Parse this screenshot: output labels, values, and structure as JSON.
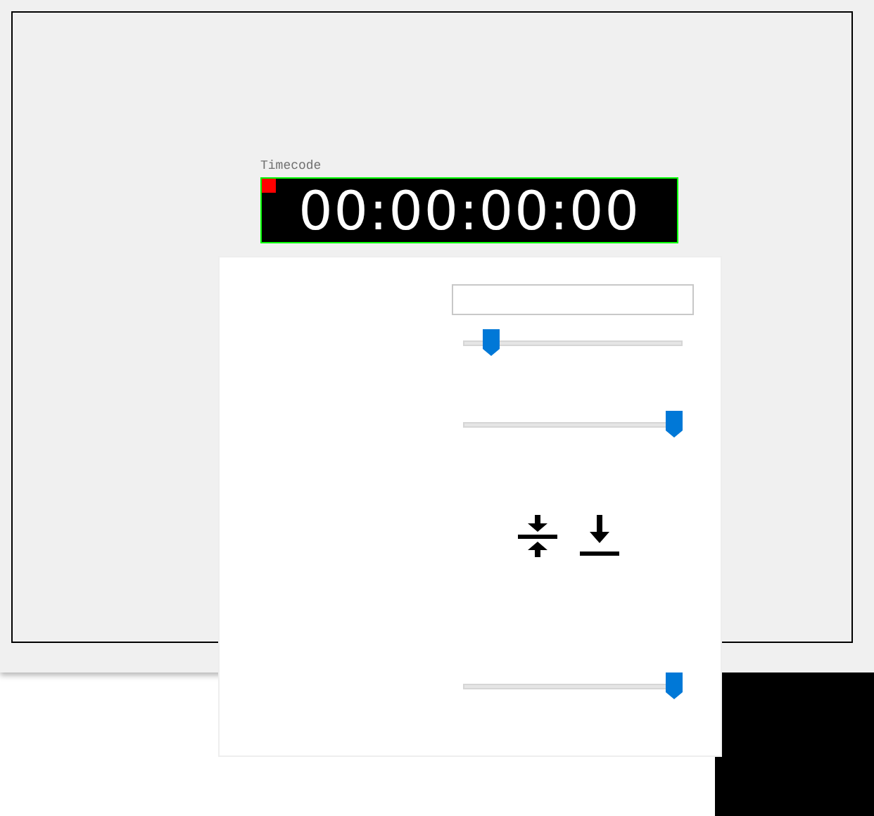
{
  "timecode": {
    "label": "Timecode",
    "value": "00:00:00:00",
    "marker": true
  },
  "panel": {
    "controls": [
      {
        "kind": "field"
      },
      {
        "kind": "slider",
        "level": 0.1
      },
      {
        "kind": "slider",
        "level": 1
      },
      {
        "kind": "icons"
      },
      {
        "kind": "slider",
        "level": 1
      }
    ]
  }
}
